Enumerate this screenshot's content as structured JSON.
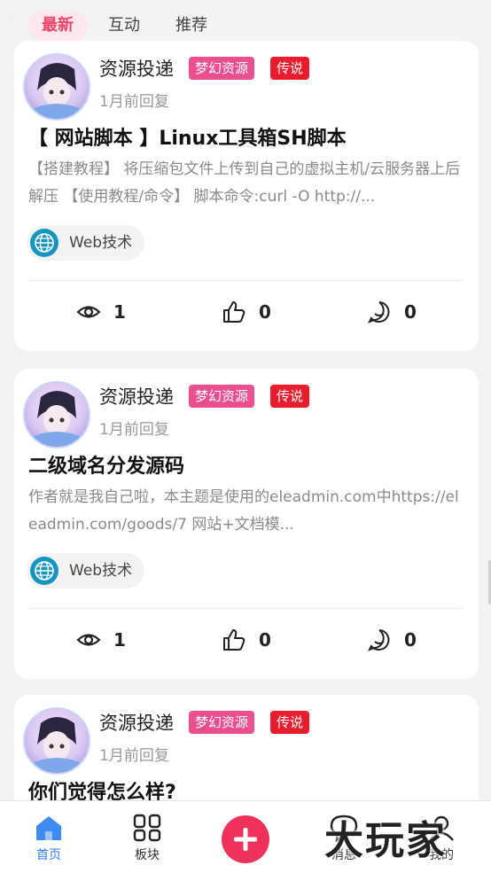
{
  "status_ghost": "3",
  "tabs": [
    {
      "label": "最新",
      "active": true
    },
    {
      "label": "互动",
      "active": false
    },
    {
      "label": "推荐",
      "active": false
    }
  ],
  "posts": [
    {
      "author": "资源投递",
      "badge1": "梦幻资源",
      "badge2": "传说",
      "time": "1月前回复",
      "title": "【 网站脚本 】Linux工具箱SH脚本",
      "excerpt": "【搭建教程】 将压缩包文件上传到自己的虚拟主机/云服务器上后解压 【使用教程/命令】 脚本命令:curl -O http://...",
      "tag": "Web技术",
      "views": "1",
      "likes": "0",
      "comments": "0"
    },
    {
      "author": "资源投递",
      "badge1": "梦幻资源",
      "badge2": "传说",
      "time": "1月前回复",
      "title": "二级域名分发源码",
      "excerpt": "作者就是我自己啦，本主题是使用的eleadmin.com中https://eleadmin.com/goods/7 网站+文档模...",
      "tag": "Web技术",
      "views": "1",
      "likes": "0",
      "comments": "0"
    },
    {
      "author": "资源投递",
      "badge1": "梦幻资源",
      "badge2": "传说",
      "time": "1月前回复",
      "title": "你们觉得怎么样?"
    }
  ],
  "nav": {
    "home": "首页",
    "boards": "板块",
    "messages": "消息",
    "mine": "我的"
  },
  "watermark": "大玩家",
  "colors": {
    "accent_pink": "#f0466e",
    "badge_pink": "#ea4f8f",
    "badge_red": "#e81c2d",
    "nav_active": "#2d7ff0",
    "add_button": "#f0325a"
  }
}
